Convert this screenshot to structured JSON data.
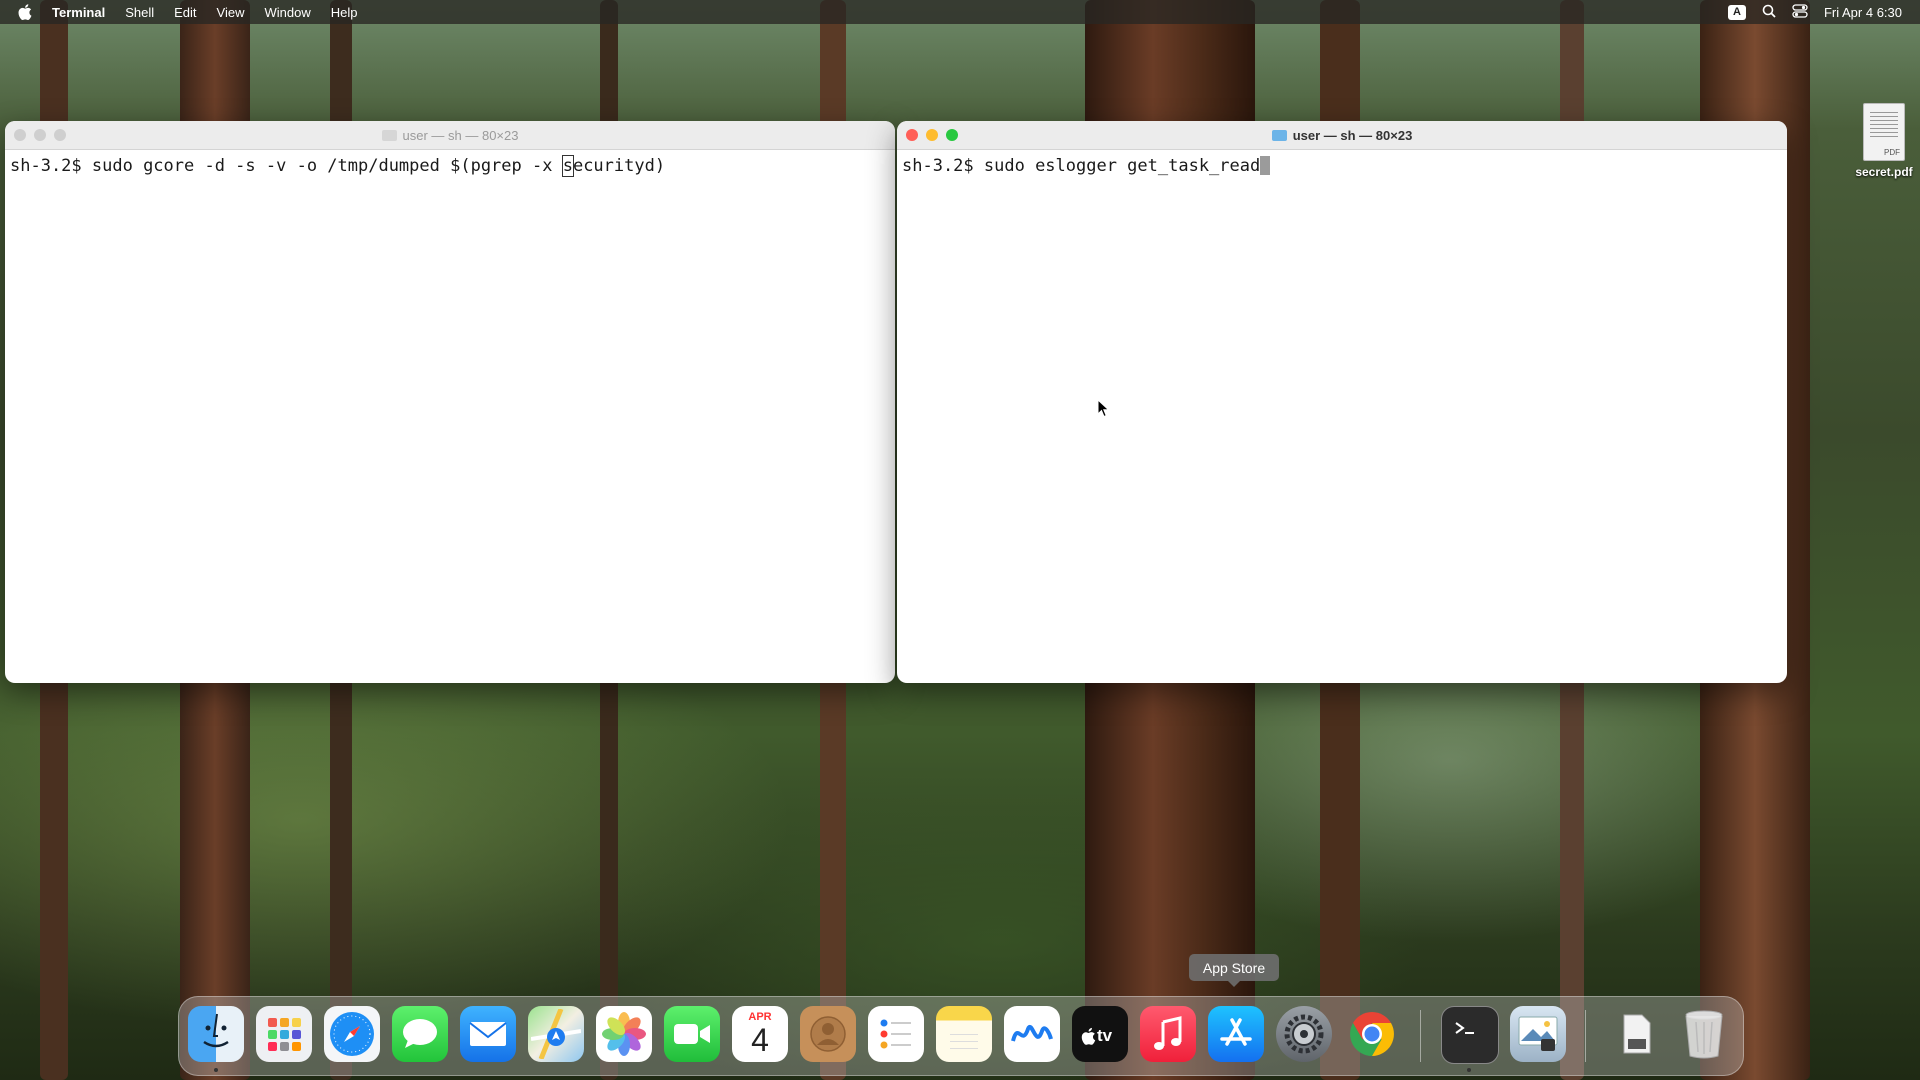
{
  "menubar": {
    "apple_icon": "apple-logo-icon",
    "app_name": "Terminal",
    "menus": [
      "Shell",
      "Edit",
      "View",
      "Window",
      "Help"
    ],
    "input_badge": "A",
    "datetime": "Fri Apr 4  6:30"
  },
  "windows": [
    {
      "title": "user — sh — 80×23",
      "prompt": "sh-3.2$",
      "command_before_cursor": " sudo gcore -d -s -v -o /tmp/dumped $(pgrep -x ",
      "cursor_char": "s",
      "command_after_cursor": "ecurityd)",
      "active": false
    },
    {
      "title": "user — sh — 80×23",
      "prompt": "sh-3.2$",
      "command": " sudo eslogger get_task_read",
      "active": true
    }
  ],
  "desktop": {
    "file_name": "secret.pdf",
    "file_tag": "PDF"
  },
  "tooltip": "App Store",
  "calendar": {
    "month": "APR",
    "day": "4"
  },
  "colors": {
    "close": "#ff5f57",
    "minimize": "#febc2e",
    "zoom": "#28c840",
    "inactive_light": "#cfcfcf"
  },
  "dock": [
    "finder-icon",
    "launchpad-icon",
    "safari-icon",
    "messages-icon",
    "mail-icon",
    "maps-icon",
    "photos-icon",
    "facetime-icon",
    "calendar-icon",
    "contacts-icon",
    "reminders-icon",
    "notes-icon",
    "freeform-icon",
    "apple-tv-icon",
    "music-icon",
    "app-store-icon",
    "system-settings-icon",
    "chrome-icon",
    "terminal-icon",
    "preview-icon",
    "downloads-stack-icon",
    "trash-icon"
  ]
}
